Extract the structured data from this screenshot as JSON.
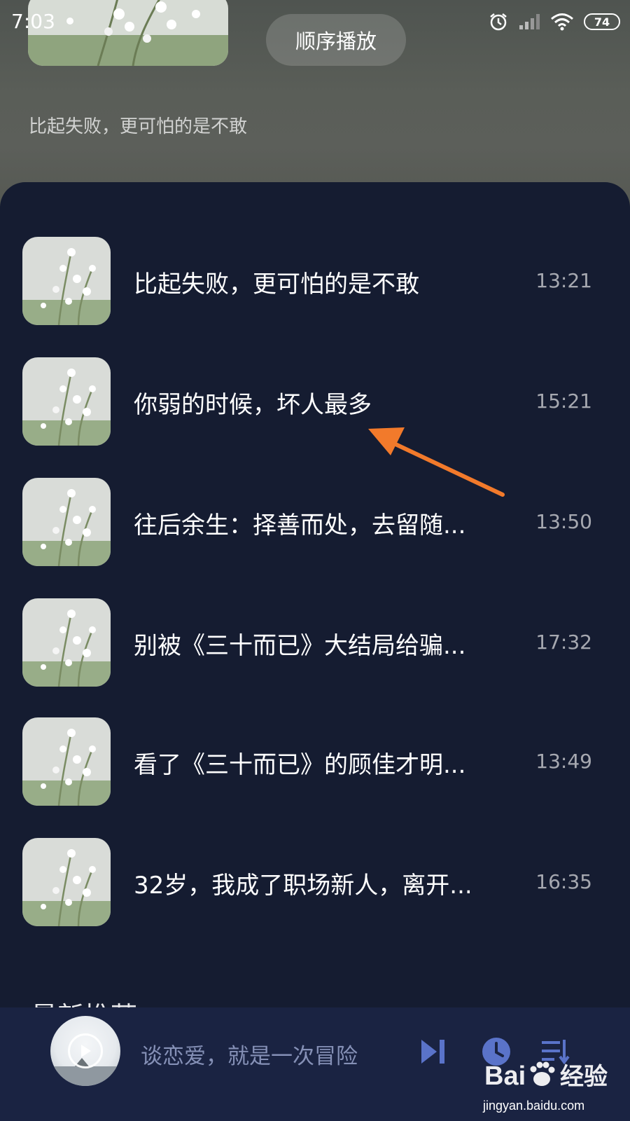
{
  "status_bar": {
    "time": "7:03",
    "battery": "74",
    "icons": [
      "alarm-icon",
      "signal-icon",
      "wifi-icon",
      "battery-icon"
    ]
  },
  "header": {
    "play_order_label": "顺序播放",
    "description": "比起失败，更可怕的是不敢"
  },
  "playlist": {
    "items": [
      {
        "title": "比起失败，更可怕的是不敢",
        "duration": "13:21"
      },
      {
        "title": "你弱的时候，坏人最多",
        "duration": "15:21"
      },
      {
        "title": "往后余生：择善而处，去留随...",
        "duration": "13:50"
      },
      {
        "title": "别被《三十而已》大结局给骗...",
        "duration": "17:32"
      },
      {
        "title": "看了《三十而已》的顾佳才明...",
        "duration": "13:49"
      },
      {
        "title": "32岁，我成了职场新人，离开...",
        "duration": "16:35"
      }
    ]
  },
  "section_peek": "最新推荐",
  "player": {
    "now_playing": "谈恋爱，就是一次冒险",
    "icons": [
      "play-icon",
      "next-track-icon",
      "clock-icon",
      "playlist-icon"
    ]
  },
  "annotation": {
    "color": "#f27a2b"
  },
  "watermark": {
    "brand": "Baidu经验",
    "url": "jingyan.baidu.com"
  },
  "colors": {
    "sheet_bg": "#151c31",
    "player_bg": "#1a2342",
    "icon_accent": "#5a73c9"
  }
}
